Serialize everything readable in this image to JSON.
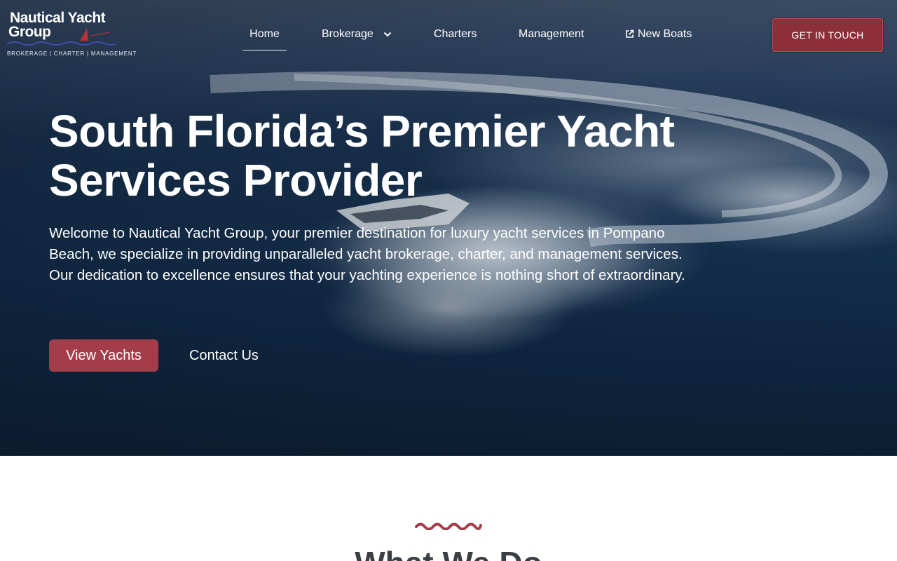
{
  "colors": {
    "brand_red": "#8d2f38",
    "button_red": "#a33d49",
    "accent_squiggle": "#a33d49",
    "ocean_dark": "#14304e",
    "heading_dark": "#3a3f46"
  },
  "logo": {
    "line1": "Nautical Yacht",
    "line2": "Group",
    "tagline": "BROKERAGE | CHARTER | MANAGEMENT"
  },
  "nav": {
    "items": [
      {
        "label": "Home",
        "active": true
      },
      {
        "label": "Brokerage",
        "has_dropdown": true,
        "icon": "chevron-down-icon"
      },
      {
        "label": "Charters"
      },
      {
        "label": "Management"
      },
      {
        "label": "New Boats",
        "icon": "external-link-icon"
      }
    ],
    "cta_label": "GET IN TOUCH"
  },
  "hero": {
    "title": "South Florida’s Premier Yacht Services Provider",
    "description": "Welcome to Nautical Yacht Group, your premier destination for luxury yacht services in Pompano Beach, we specialize in providing unparalleled yacht brokerage, charter, and management services. Our dedication to excellence ensures that your yachting experience is nothing short of extraordinary.",
    "primary_button": "View Yachts",
    "secondary_button": "Contact Us"
  },
  "section": {
    "title": "What We Do",
    "accent_icon": "wave-squiggle-icon"
  }
}
